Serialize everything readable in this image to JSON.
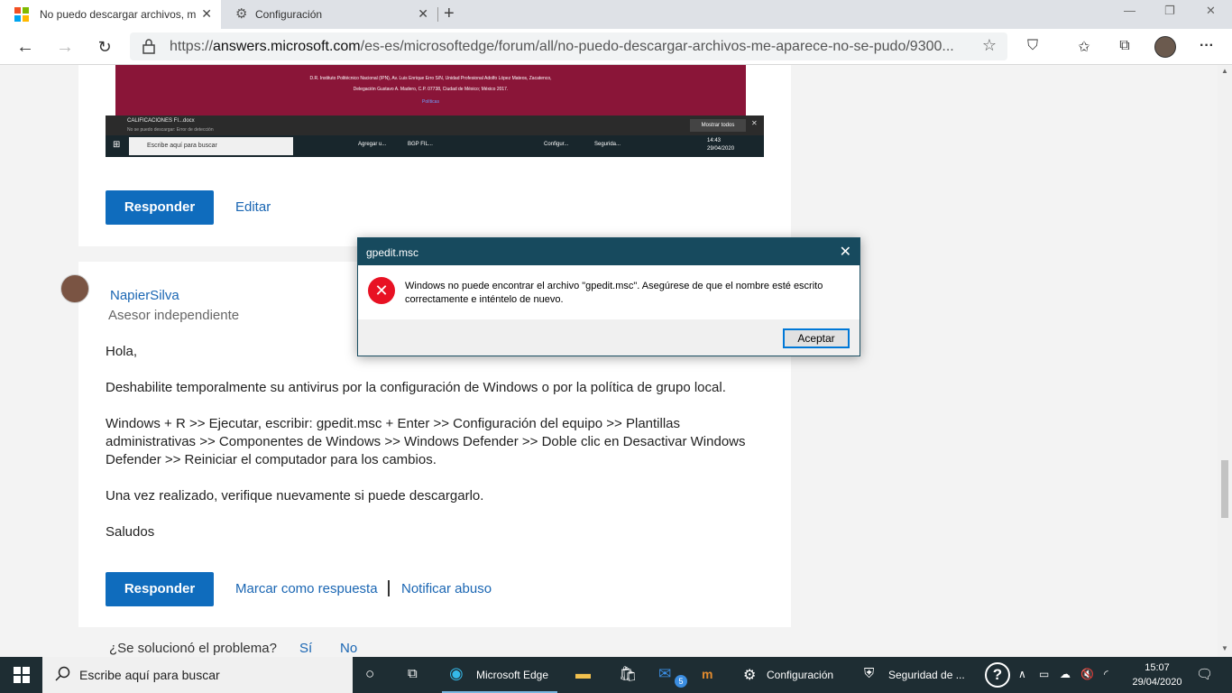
{
  "browser": {
    "tabs": [
      {
        "title": "No puedo descargar archivos, m",
        "active": true
      },
      {
        "title": "Configuración",
        "active": false
      }
    ],
    "url_prefix": "https://",
    "url_host": "answers.microsoft.com",
    "url_path": "/es-es/microsoftedge/forum/all/no-puedo-descargar-archivos-me-aparece-no-se-pudo/9300..."
  },
  "post_image": {
    "footer_line1": "D.R. Instituto Politécnico Nacional (IPN), Av. Luis Enrique Erro S/N, Unidad Profesional Adolfo López Mateos, Zacatenco,",
    "footer_line2": "Delegación Gustavo A. Madero, C.P. 07738, Ciudad de México; México 2017.",
    "footer_link": "Políticas",
    "download_file": "CALIFICACIONES FI...docx",
    "download_status": "No se puedo descargar: Error de detección",
    "show_all": "Mostrar todos",
    "search_placeholder": "Escribe aquí para buscar",
    "apps": [
      "Agregar u...",
      "BGP FIL...",
      "Configur...",
      "Segurida..."
    ],
    "time": "14:43",
    "date": "29/04/2020"
  },
  "first_post": {
    "reply_label": "Responder",
    "edit_label": "Editar"
  },
  "reply": {
    "author": "NapierSilva",
    "role": "Asesor independiente",
    "greeting": "Hola,",
    "p1": "Deshabilite temporalmente su antivirus por la configuración de Windows o por la política de grupo local.",
    "p2": "Windows + R >> Ejecutar, escribir: gpedit.msc + Enter >> Configuración del equipo >> Plantillas administrativas >> Componentes de Windows >> Windows Defender >> Doble clic en Desactivar Windows Defender >> Reiniciar el computador para los cambios.",
    "p3": "Una vez realizado, verifique nuevamente si puede descargarlo.",
    "signoff": "Saludos",
    "reply_label": "Responder",
    "mark_answer": "Marcar como respuesta",
    "report": "Notificar abuso"
  },
  "feedback": {
    "question": "¿Se solucionó el problema?",
    "yes": "Sí",
    "no": "No"
  },
  "dialog": {
    "title": "gpedit.msc",
    "message": "Windows no puede encontrar el archivo \"gpedit.msc\". Asegúrese de que el nombre esté escrito correctamente e inténtelo de nuevo.",
    "ok": "Aceptar"
  },
  "taskbar": {
    "search_placeholder": "Escribe aquí para buscar",
    "edge": "Microsoft Edge",
    "settings": "Configuración",
    "security": "Seguridad de ...",
    "mail_badge": "5",
    "time": "15:07",
    "date": "29/04/2020"
  },
  "colors": {
    "accent": "#0f6cbd",
    "link": "#1a66b3",
    "dialog_title": "#174a5e",
    "error": "#e81123"
  }
}
